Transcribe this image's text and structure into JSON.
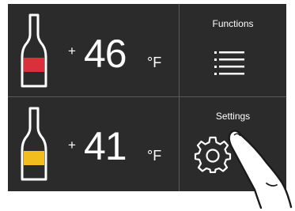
{
  "zones": [
    {
      "sign": "+",
      "temperature": "46",
      "unit": "°F",
      "accent_color": "#d9303b",
      "icon": "wine-bottle-icon"
    },
    {
      "sign": "+",
      "temperature": "41",
      "unit": "°F",
      "accent_color": "#f2be1f",
      "icon": "wine-bottle-icon"
    }
  ],
  "menu": {
    "functions_label": "Functions",
    "functions_icon": "menu-icon",
    "settings_label": "Settings",
    "settings_icon": "gear-icon"
  },
  "colors": {
    "panel_background": "#2b2b2b",
    "divider": "#5a5a5a",
    "text": "#ffffff"
  },
  "overlay": {
    "icon": "pointing-finger-icon"
  }
}
